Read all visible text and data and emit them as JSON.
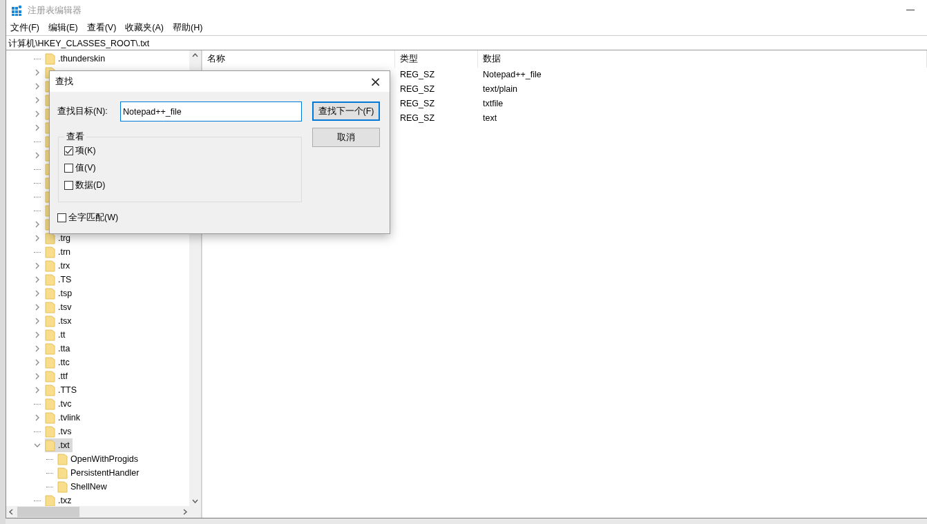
{
  "window": {
    "title": "注册表编辑器"
  },
  "menu": [
    "文件(F)",
    "编辑(E)",
    "查看(V)",
    "收藏夹(A)",
    "帮助(H)"
  ],
  "address": "计算机\\HKEY_CLASSES_ROOT\\.txt",
  "tree": [
    {
      "label": ".thunderskin",
      "expandable": false,
      "selected": false
    },
    {
      "expandable": true,
      "expanded": false,
      "selected": false
    },
    {
      "expandable": true,
      "expanded": false,
      "selected": false
    },
    {
      "expandable": true,
      "expanded": false,
      "selected": false
    },
    {
      "expandable": true,
      "expanded": false,
      "selected": false
    },
    {
      "expandable": true,
      "expanded": false,
      "selected": false
    },
    {
      "expandable": false,
      "selected": false
    },
    {
      "expandable": true,
      "expanded": false,
      "selected": false
    },
    {
      "expandable": false,
      "selected": false
    },
    {
      "expandable": false,
      "selected": false
    },
    {
      "expandable": false,
      "selected": false
    },
    {
      "expandable": false,
      "selected": false
    },
    {
      "expandable": true,
      "expanded": false,
      "selected": false
    },
    {
      "label": ".trg",
      "expandable": true,
      "expanded": false,
      "selected": false
    },
    {
      "label": ".trn",
      "expandable": false,
      "selected": false
    },
    {
      "label": ".trx",
      "expandable": true,
      "expanded": false,
      "selected": false
    },
    {
      "label": ".TS",
      "expandable": true,
      "expanded": false,
      "selected": false
    },
    {
      "label": ".tsp",
      "expandable": true,
      "expanded": false,
      "selected": false
    },
    {
      "label": ".tsv",
      "expandable": true,
      "expanded": false,
      "selected": false
    },
    {
      "label": ".tsx",
      "expandable": true,
      "expanded": false,
      "selected": false
    },
    {
      "label": ".tt",
      "expandable": true,
      "expanded": false,
      "selected": false
    },
    {
      "label": ".tta",
      "expandable": true,
      "expanded": false,
      "selected": false
    },
    {
      "label": ".ttc",
      "expandable": true,
      "expanded": false,
      "selected": false
    },
    {
      "label": ".ttf",
      "expandable": true,
      "expanded": false,
      "selected": false
    },
    {
      "label": ".TTS",
      "expandable": true,
      "expanded": false,
      "selected": false
    },
    {
      "label": ".tvc",
      "expandable": false,
      "selected": false
    },
    {
      "label": ".tvlink",
      "expandable": true,
      "expanded": false,
      "selected": false
    },
    {
      "label": ".tvs",
      "expandable": false,
      "selected": false
    },
    {
      "label": ".txt",
      "expandable": true,
      "expanded": true,
      "selected": true,
      "children": [
        {
          "label": "OpenWithProgids",
          "expandable": false,
          "selected": false
        },
        {
          "label": "PersistentHandler",
          "expandable": false,
          "selected": false
        },
        {
          "label": "ShellNew",
          "expandable": false,
          "selected": false
        }
      ]
    },
    {
      "label": ".txz",
      "expandable": false,
      "selected": false
    }
  ],
  "list": {
    "columns": [
      "名称",
      "类型",
      "数据"
    ],
    "rows": [
      {
        "type": "REG_SZ",
        "data": "Notepad++_file"
      },
      {
        "type": "REG_SZ",
        "data": "text/plain"
      },
      {
        "type": "REG_SZ",
        "data": "txtfile"
      },
      {
        "type": "REG_SZ",
        "data": "text"
      }
    ]
  },
  "dialog": {
    "title": "查找",
    "close": "×",
    "find_label": "查找目标(N):",
    "find_value": "Notepad++_file",
    "group_title": "查看",
    "options": [
      {
        "label": "项(K)",
        "checked": true
      },
      {
        "label": "值(V)",
        "checked": false
      },
      {
        "label": "数据(D)",
        "checked": false
      }
    ],
    "whole_word": {
      "label": "全字匹配(W)",
      "checked": false
    },
    "buttons": [
      {
        "label": "查找下一个(F)",
        "default": true
      },
      {
        "label": "取消",
        "default": false
      }
    ]
  }
}
